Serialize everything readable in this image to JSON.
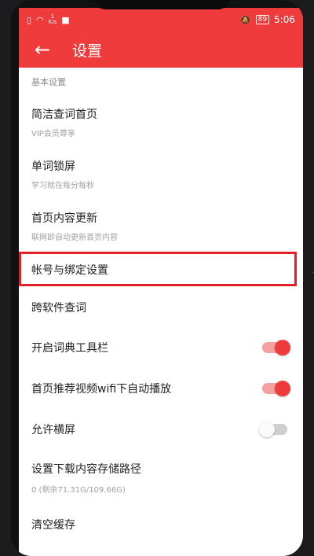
{
  "statusbar": {
    "speed_value": "1",
    "speed_unit": "K/s",
    "battery": "89",
    "time": "5:06"
  },
  "appbar": {
    "back_icon": "back-arrow-icon",
    "title": "设置"
  },
  "section": {
    "header": "基本设置"
  },
  "items": [
    {
      "label": "简洁查词首页",
      "sub": "VIP会员尊享"
    },
    {
      "label": "单词锁屏",
      "sub": "学习就在每分每秒"
    },
    {
      "label": "首页内容更新",
      "sub": "联网即自动更新首页内容"
    },
    {
      "label": "帐号与绑定设置"
    },
    {
      "label": "跨软件查词"
    },
    {
      "label": "开启词典工具栏",
      "toggle": true
    },
    {
      "label": "首页推荐视频wifi下自动播放",
      "toggle": true
    },
    {
      "label": "允许横屏",
      "toggle": false
    },
    {
      "label": "设置下载内容存储路径",
      "sub": "0 (剩余71.31G/109.66G)"
    },
    {
      "label": "清空缓存"
    }
  ],
  "colors": {
    "accent": "#ef3b3b",
    "highlight": "#e52027"
  }
}
